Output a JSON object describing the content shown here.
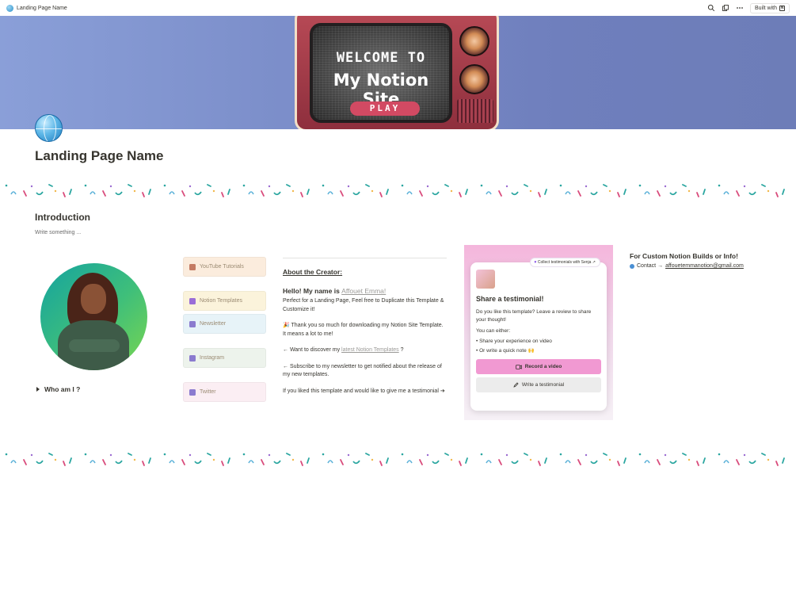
{
  "topbar": {
    "breadcrumb": "Landing Page Name",
    "built_with": "Built with"
  },
  "cover": {
    "line1": "WELCOME TO",
    "line2": "My Notion Site",
    "play": "PLAY"
  },
  "page": {
    "title": "Landing Page Name",
    "intro_heading": "Introduction",
    "intro_text": "Write something ..."
  },
  "toggle": {
    "label": "Who am I ?"
  },
  "links": [
    {
      "label": "YouTube Tutorials"
    },
    {
      "label": "Notion Templates"
    },
    {
      "label": "Newsletter"
    },
    {
      "label": "Instagram"
    },
    {
      "label": "Twitter"
    }
  ],
  "about": {
    "heading": "About the Creator:",
    "hello_prefix": "Hello! My name is ",
    "name": "Affouet Emma!",
    "p1": "Perfect for a Landing Page, Feel free to Duplicate this Template & Customize it!",
    "p2": "🎉 Thank you so much for downloading my Notion Site Template. It means a lot to me!",
    "p3_prefix": "← Want to discover my ",
    "p3_link": "latest Notion Templates",
    "p3_suffix": " ?",
    "p4": "← Subscribe to my newsletter to get notified about the release of my new templates.",
    "p5": "If you liked this template and would like to give me a testimonial ➔"
  },
  "testimonial": {
    "tag": "Collect testimonials with Senja ↗",
    "title": "Share a testimonial!",
    "desc": "Do you like this template? Leave a review to share your thought!",
    "either": "You can either:",
    "opt1": "Share your experience on video",
    "opt2": "Or write a quick note 🙌",
    "record": "Record a video",
    "write": "Write a testimonial"
  },
  "custom": {
    "heading": "For Custom Notion Builds or Info!",
    "contact_label": "Contact → ",
    "email": "affouetemmanotion@gmail.com"
  },
  "colors": {
    "accent_pink": "#f199d2",
    "text": "#37352f",
    "muted": "#9b9a97"
  }
}
